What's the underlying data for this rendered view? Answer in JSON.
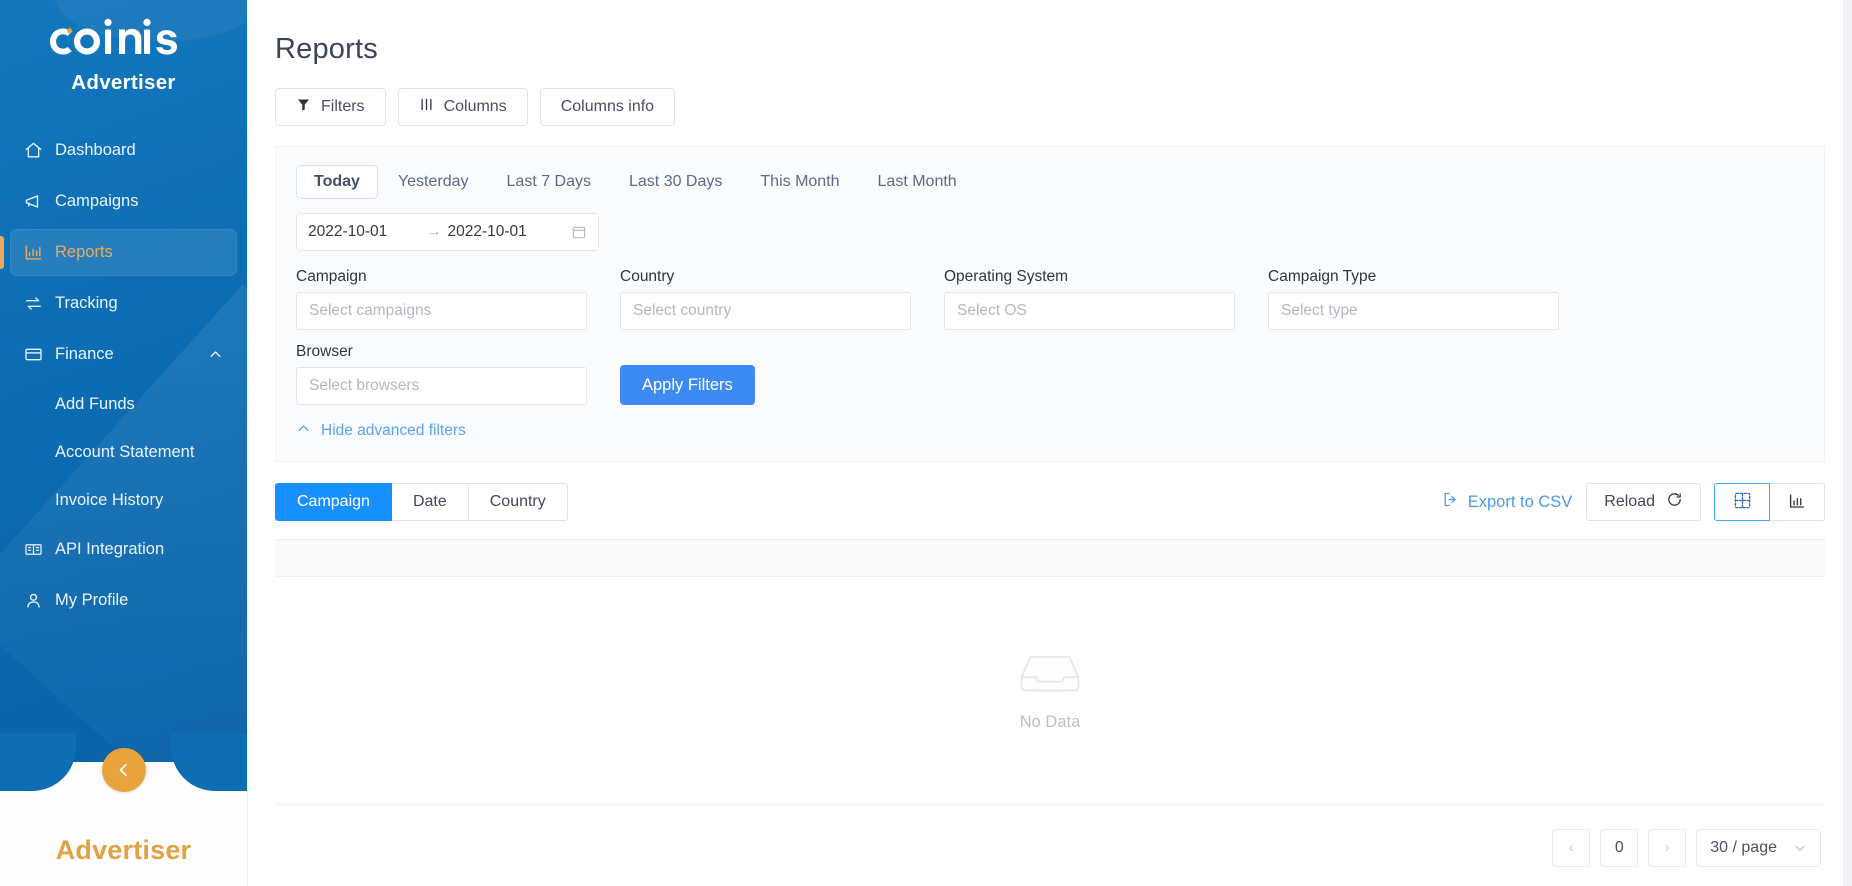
{
  "sidebar": {
    "logo_text": "coinis",
    "brand_sub": "Advertiser",
    "brand_bottom": "Advertiser",
    "collapse_label": "<",
    "items": [
      {
        "label": "Dashboard",
        "icon": "home-icon"
      },
      {
        "label": "Campaigns",
        "icon": "megaphone-icon"
      },
      {
        "label": "Reports",
        "icon": "bar-chart-icon"
      },
      {
        "label": "Tracking",
        "icon": "exchange-icon"
      },
      {
        "label": "Finance",
        "icon": "credit-card-icon"
      },
      {
        "label": "Add Funds",
        "icon": ""
      },
      {
        "label": "Account Statement",
        "icon": ""
      },
      {
        "label": "Invoice History",
        "icon": ""
      },
      {
        "label": "API Integration",
        "icon": "book-icon"
      },
      {
        "label": "My Profile",
        "icon": "user-icon"
      }
    ]
  },
  "header": {
    "title": "Reports"
  },
  "toolbar": {
    "filters_label": "Filters",
    "columns_label": "Columns",
    "columns_info_label": "Columns info"
  },
  "date_ranges": {
    "tabs": [
      "Today",
      "Yesterday",
      "Last 7 Days",
      "Last 30 Days",
      "This Month",
      "Last Month"
    ],
    "active": "Today",
    "start": "2022-10-01",
    "end": "2022-10-01",
    "separator": "→"
  },
  "filters": {
    "campaign": {
      "label": "Campaign",
      "placeholder": "Select campaigns",
      "value": ""
    },
    "country": {
      "label": "Country",
      "placeholder": "Select country",
      "value": ""
    },
    "operating_system": {
      "label": "Operating System",
      "placeholder": "Select OS",
      "value": ""
    },
    "campaign_type": {
      "label": "Campaign Type",
      "placeholder": "Select type",
      "value": ""
    },
    "browser": {
      "label": "Browser",
      "placeholder": "Select browsers",
      "value": ""
    },
    "apply_label": "Apply Filters",
    "advanced_toggle_label": "Hide advanced filters"
  },
  "grouping": {
    "tabs": [
      "Campaign",
      "Date",
      "Country"
    ],
    "active": "Campaign"
  },
  "actions": {
    "export_label": "Export to CSV",
    "reload_label": "Reload",
    "view_table_title": "Table view",
    "view_chart_title": "Chart view",
    "active_view": "table"
  },
  "table": {
    "empty_text": "No Data"
  },
  "pagination": {
    "prev": "‹",
    "page": "0",
    "next": "›",
    "page_size": "30 / page"
  },
  "colors": {
    "sidebar_blue": "#0d6eb4",
    "accent_gold": "#e8a33d",
    "primary_blue": "#1890ff",
    "apply_blue": "#3d8bf2",
    "link_blue": "#4a9ae6"
  }
}
